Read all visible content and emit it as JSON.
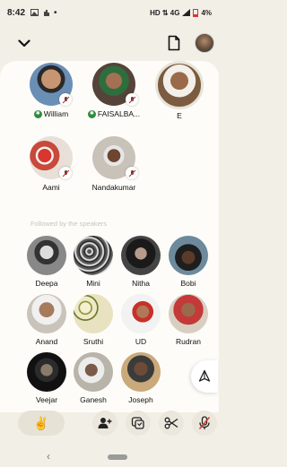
{
  "status": {
    "time": "8:42",
    "network": "HD ⇅ 4G",
    "battery": "4%"
  },
  "header": {
    "collapse_icon": "chevron-down-icon",
    "document_icon": "document-icon"
  },
  "speakers": [
    {
      "name": "William",
      "moderator": true,
      "muted": true
    },
    {
      "name": "FAISALBA...",
      "moderator": true,
      "muted": true
    },
    {
      "name": "E",
      "moderator": false,
      "muted": false
    },
    {
      "name": "Aami",
      "moderator": false,
      "muted": true
    },
    {
      "name": "Nandakumar",
      "moderator": false,
      "muted": true
    }
  ],
  "section_label": "Followed by the speakers",
  "audience": [
    {
      "name": "Deepa"
    },
    {
      "name": "Mini"
    },
    {
      "name": "Nitha"
    },
    {
      "name": "Bobi"
    },
    {
      "name": "Anand"
    },
    {
      "name": "Sruthi"
    },
    {
      "name": "UD"
    },
    {
      "name": "Rudran"
    },
    {
      "name": "Veejar"
    },
    {
      "name": "Ganesh"
    },
    {
      "name": "Joseph"
    }
  ],
  "toolbar": {
    "hand_icon": "raise-hand-icon",
    "add_user_icon": "add-user-icon",
    "chat_icon": "chat-icon",
    "clip_icon": "scissors-icon",
    "mic_icon": "mic-off-icon"
  },
  "colors": {
    "background": "#f2efe6",
    "sheet": "#fdfcf8",
    "moderator_badge": "#2e8b3e",
    "muted_red": "#d3372f"
  }
}
